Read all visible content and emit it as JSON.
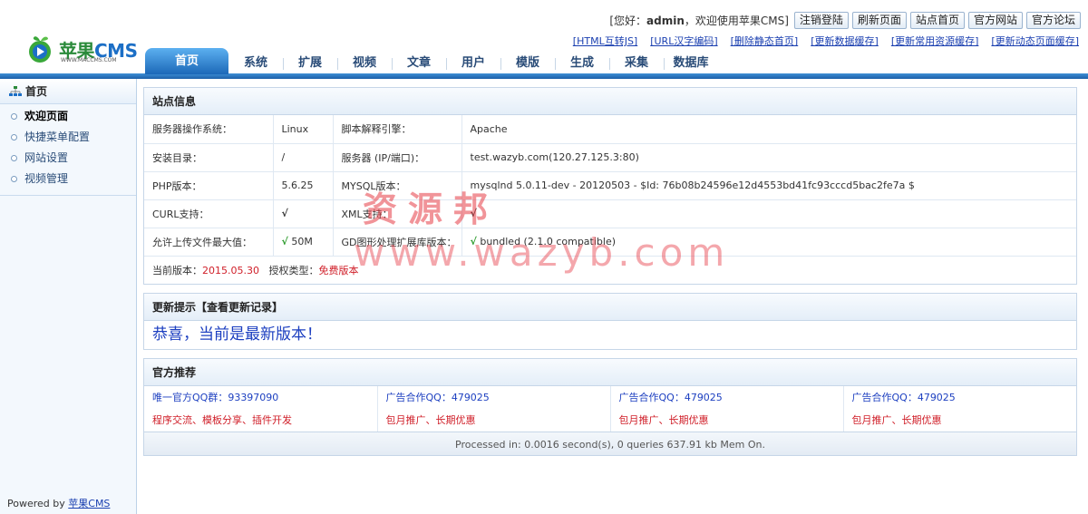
{
  "brand": {
    "name_green": "苹果",
    "name_blue": "CMS",
    "site": "WWW.MACCMS.COM"
  },
  "topbar": {
    "greet_prefix": "[您好：",
    "user": "admin",
    "greet_suffix": "，欢迎使用苹果CMS]",
    "buttons": [
      "注销登陆",
      "刷新页面",
      "站点首页",
      "官方网站",
      "官方论坛"
    ]
  },
  "quicklinks": [
    "[HTML互转JS]",
    "[URL汉字编码]",
    "[删除静态首页]",
    "[更新数据缓存]",
    "[更新常用资源缓存]",
    "[更新动态页面缓存]"
  ],
  "nav": [
    "首页",
    "系统",
    "扩展",
    "视频",
    "文章",
    "用户",
    "模版",
    "生成",
    "采集",
    "数据库"
  ],
  "sidebar": {
    "title": "首页",
    "items": [
      "欢迎页面",
      "快捷菜单配置",
      "网站设置",
      "视频管理"
    ],
    "powered_prefix": "Powered by ",
    "powered_link": "苹果CMS"
  },
  "siteinfo": {
    "title": "站点信息",
    "rows": [
      [
        "服务器操作系统：",
        "Linux",
        "脚本解释引擎：",
        "Apache"
      ],
      [
        "安装目录：",
        "/",
        "服务器 (IP/端口)：",
        "test.wazyb.com(120.27.125.3:80)"
      ],
      [
        "PHP版本：",
        "5.6.25",
        "MYSQL版本：",
        "mysqlnd 5.0.11-dev - 20120503 - $Id: 76b08b24596e12d4553bd41fc93cccd5bac2fe7a $"
      ]
    ],
    "curl_label": "CURL支持：",
    "curl_val": "√",
    "xml_label": "XML支持：",
    "xml_val": "√",
    "upload_label": "允许上传文件最大值：",
    "upload_check": "√",
    "upload_val": " 50M",
    "gd_label": "GD图形处理扩展库版本：",
    "gd_check": "√",
    "gd_val": " bundled (2.1.0 compatible)",
    "version_label": "当前版本：",
    "version": "2015.05.30",
    "license_label": "授权类型：",
    "license": "免费版本"
  },
  "update": {
    "title_prefix": "更新提示",
    "title_link": "【查看更新记录】",
    "message": "恭喜，当前是最新版本！"
  },
  "recommend": {
    "title": "官方推荐",
    "cols": [
      {
        "qq": "唯一官方QQ群：93397090",
        "desc": "程序交流、模板分享、插件开发"
      },
      {
        "qq": "广告合作QQ：479025",
        "desc": "包月推广、长期优惠"
      },
      {
        "qq": "广告合作QQ：479025",
        "desc": "包月推广、长期优惠"
      },
      {
        "qq": "广告合作QQ：479025",
        "desc": "包月推广、长期优惠"
      }
    ]
  },
  "processed": "Processed in: 0.0016 second(s), 0 queries 637.91 kb Mem On.",
  "watermark": {
    "line1": "资源邦",
    "line2": "www.wazyb.com"
  }
}
